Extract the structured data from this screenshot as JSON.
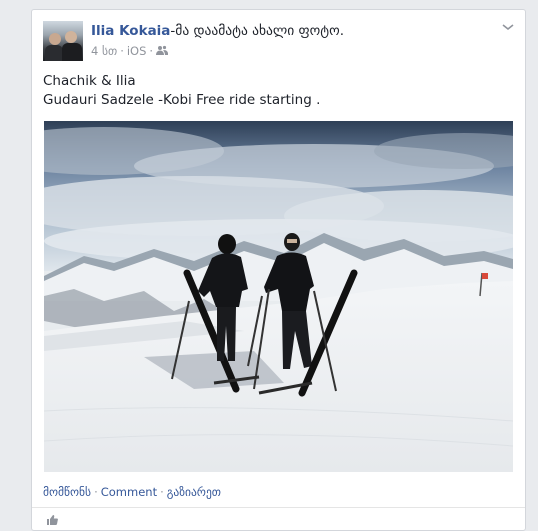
{
  "post": {
    "author": "Ilia Kokaia",
    "action": "-მა დაამატა ახალი ფოტო.",
    "time": "4 სთ",
    "platform": "iOS",
    "text_line1": "Chachik & Ilia",
    "text_line2": "Gudauri Sadzele -Kobi Free ride starting ."
  },
  "footer": {
    "like": "მომწონს",
    "comment": "Comment",
    "share": "გაზიარეთ"
  },
  "icons": {
    "audience": "friends-icon",
    "menu": "chevron-down-icon"
  },
  "colors": {
    "link": "#365899",
    "meta": "#90949c",
    "background": "#e9ebee"
  }
}
